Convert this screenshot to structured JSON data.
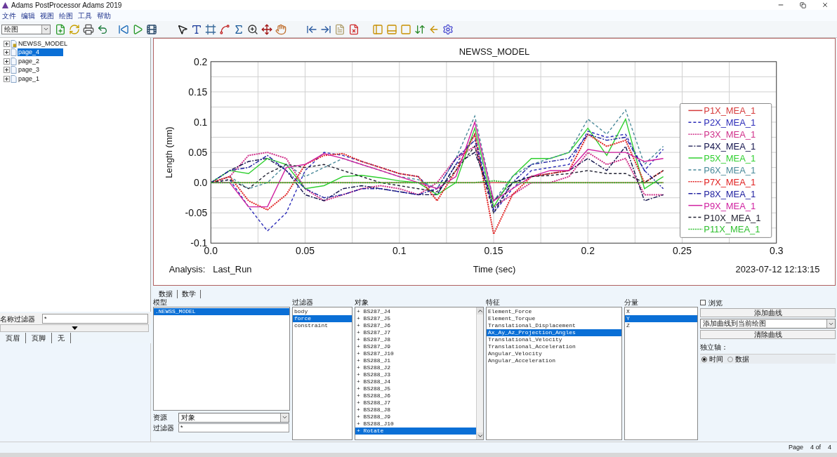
{
  "window": {
    "title": "Adams PostProcessor Adams 2019"
  },
  "menu": [
    "文件",
    "编辑",
    "视图",
    "绘图",
    "工具",
    "帮助"
  ],
  "toolbar": {
    "mode_select": "绘图"
  },
  "tree": [
    {
      "label": "NEWSS_MODEL",
      "kind": "model",
      "selected": false,
      "expanded": false
    },
    {
      "label": "page_4",
      "kind": "page",
      "selected": true,
      "expanded": false
    },
    {
      "label": "page_2",
      "kind": "page",
      "selected": false,
      "expanded": false
    },
    {
      "label": "page_3",
      "kind": "page",
      "selected": false,
      "expanded": false
    },
    {
      "label": "page_1",
      "kind": "page",
      "selected": false,
      "expanded": false
    }
  ],
  "name_filter": {
    "label": "名称过滤器",
    "value": "*"
  },
  "header_tabs": [
    "页眉",
    "页脚",
    "无"
  ],
  "plot": {
    "analysis_label": "Analysis:",
    "analysis_name": "Last_Run",
    "timestamp": "2023-07-12 12:13:15",
    "chart_data": {
      "type": "line",
      "title": "NEWSS_MODEL",
      "xlabel": "Time (sec)",
      "ylabel": "Length (mm)",
      "grid": true,
      "legend": true,
      "x": [
        0,
        0.01,
        0.02,
        0.03,
        0.04,
        0.05,
        0.06,
        0.07,
        0.08,
        0.09,
        0.1,
        0.11,
        0.12,
        0.13,
        0.14,
        0.15,
        0.16,
        0.17,
        0.18,
        0.19,
        0.2,
        0.21,
        0.22,
        0.23,
        0.24
      ],
      "xlim": [
        0,
        0.3
      ],
      "ylim": [
        -0.1,
        0.2
      ],
      "xticks": [
        {
          "value": 0,
          "label": "0.0"
        },
        0.05,
        0.1,
        0.15,
        0.2,
        0.25,
        0.3
      ],
      "yticks": [
        -0.1,
        -0.05,
        {
          "value": 0,
          "label": "0.0"
        },
        0.05,
        0.1,
        0.15,
        0.2
      ],
      "series": [
        {
          "name": "P1X_MEA_1",
          "color": "#d63a3a",
          "line_style": "solid",
          "values": [
            0,
            0,
            0,
            0,
            0,
            0,
            0,
            0,
            0,
            0,
            0,
            0,
            0,
            0,
            0,
            0,
            0,
            0,
            0,
            0,
            0,
            0,
            0,
            0,
            0
          ]
        },
        {
          "name": "P2X_MEA_1",
          "color": "#2a2ab8",
          "line_style": "dashed",
          "values": [
            0,
            0.005,
            -0.04,
            -0.08,
            -0.05,
            0.02,
            0.05,
            0.045,
            0.035,
            0.025,
            0.015,
            0.01,
            -0.02,
            0.03,
            0.08,
            -0.05,
            -0.01,
            0.02,
            0.025,
            0.03,
            0.085,
            0.075,
            0.08,
            0.02,
            0.055
          ]
        },
        {
          "name": "P3X_MEA_1",
          "color": "#d0308a",
          "line_style": "dotted",
          "values": [
            0,
            0.01,
            0.045,
            0.05,
            0.04,
            -0.01,
            -0.03,
            -0.02,
            -0.01,
            -0.005,
            -0.01,
            -0.02,
            0,
            0.04,
            0.06,
            -0.04,
            -0.02,
            0,
            0,
            0.01,
            0.05,
            0.03,
            0.04,
            -0.02,
            -0.02
          ]
        },
        {
          "name": "P4X_MEA_1",
          "color": "#10104a",
          "line_style": "dashdot",
          "values": [
            0,
            0.02,
            0.035,
            0.04,
            0.02,
            -0.02,
            -0.03,
            -0.01,
            -0.005,
            -0.01,
            -0.015,
            -0.02,
            -0.02,
            0.03,
            0.05,
            -0.03,
            0,
            0.01,
            0.015,
            0.02,
            0.04,
            0.02,
            0.06,
            -0.03,
            -0.02
          ]
        },
        {
          "name": "P5X_MEA_1",
          "color": "#30d030",
          "line_style": "solid",
          "values": [
            0,
            0.02,
            0.015,
            0.04,
            0.03,
            -0.01,
            -0.005,
            0.01,
            0.012,
            0.008,
            0.003,
            0,
            -0.02,
            0,
            0.09,
            -0.04,
            0.01,
            0.04,
            0.04,
            0.05,
            0.09,
            0.045,
            0.105,
            -0.01,
            0.01
          ]
        },
        {
          "name": "P6X_MEA_1",
          "color": "#4a8a9a",
          "line_style": "dashed",
          "values": [
            0,
            0.01,
            -0.01,
            0,
            0.03,
            0.01,
            0.025,
            0.04,
            0.03,
            0.02,
            0.01,
            0.005,
            -0.01,
            0.04,
            0.11,
            -0.03,
            0.01,
            0.03,
            0.04,
            0.05,
            0.105,
            0.08,
            0.12,
            0.03,
            0.06
          ]
        },
        {
          "name": "P7X_MEA_1",
          "color": "#e02020",
          "line_style": "dotted",
          "values": [
            0,
            0.01,
            -0.03,
            -0.045,
            -0.02,
            0.03,
            0.045,
            0.048,
            0.035,
            0.025,
            0.015,
            0.01,
            -0.03,
            0.02,
            0.08,
            -0.085,
            -0.02,
            0.01,
            0.015,
            0.02,
            0.08,
            0.06,
            0.07,
            0,
            0.02
          ]
        },
        {
          "name": "P8X_MEA_1",
          "color": "#2020a0",
          "line_style": "dashdot",
          "values": [
            0,
            0.02,
            0.025,
            0.045,
            0.02,
            -0.01,
            -0.025,
            -0.02,
            -0.01,
            -0.01,
            -0.015,
            -0.02,
            -0.01,
            0.04,
            0.07,
            -0.045,
            0,
            0.03,
            0.035,
            0.04,
            0.08,
            0.07,
            0.075,
            0.02,
            -0.01
          ]
        },
        {
          "name": "P9X_MEA_1",
          "color": "#d020a0",
          "line_style": "solid",
          "values": [
            0,
            0,
            -0.04,
            -0.04,
            0.025,
            0.03,
            0.048,
            0.04,
            0.03,
            0.02,
            0.01,
            0,
            -0.01,
            0.01,
            0.1,
            -0.03,
            -0.01,
            0.01,
            0.02,
            0.02,
            0.055,
            0.05,
            0.05,
            0.035,
            0.04
          ]
        },
        {
          "name": "P10X_MEA_1",
          "color": "#202030",
          "line_style": "dashed",
          "values": [
            0,
            0.005,
            -0.01,
            0.015,
            0.03,
            0.025,
            0.03,
            0.02,
            0.01,
            0,
            -0.005,
            -0.01,
            -0.015,
            0.02,
            0.06,
            -0.05,
            0,
            0.01,
            0.012,
            0.015,
            0.02,
            0.015,
            0.015,
            0,
            0.02
          ]
        },
        {
          "name": "P11X_MEA_1",
          "color": "#30c030",
          "line_style": "dotted",
          "values": [
            0,
            0,
            0,
            0,
            0,
            0,
            0,
            0,
            0,
            0,
            0,
            0,
            0,
            0,
            0,
            0.003,
            0,
            0,
            0,
            0,
            0,
            0,
            0,
            0,
            0
          ]
        }
      ]
    }
  },
  "data_panel": {
    "tabs": [
      "数据",
      "数学"
    ],
    "model": {
      "label": "模型",
      "items": [
        {
          "label": ".NEWSS_MODEL",
          "selected": true
        }
      ]
    },
    "filter": {
      "label": "过滤器",
      "items": [
        {
          "label": "body",
          "selected": false
        },
        {
          "label": "force",
          "selected": true
        },
        {
          "label": "constraint",
          "selected": false
        }
      ]
    },
    "objects": {
      "label": "对象",
      "items": [
        {
          "label": "+ BS287_J4",
          "selected": false
        },
        {
          "label": "+ BS287_J5",
          "selected": false
        },
        {
          "label": "+ BS287_J6",
          "selected": false
        },
        {
          "label": "+ BS287_J7",
          "selected": false
        },
        {
          "label": "+ BS287_J8",
          "selected": false
        },
        {
          "label": "+ BS287_J9",
          "selected": false
        },
        {
          "label": "+ BS287_J10",
          "selected": false
        },
        {
          "label": "+ BS288_J1",
          "selected": false
        },
        {
          "label": "+ BS288_J2",
          "selected": false
        },
        {
          "label": "+ BS288_J3",
          "selected": false
        },
        {
          "label": "+ BS288_J4",
          "selected": false
        },
        {
          "label": "+ BS288_J5",
          "selected": false
        },
        {
          "label": "+ BS288_J6",
          "selected": false
        },
        {
          "label": "+ BS288_J7",
          "selected": false
        },
        {
          "label": "+ BS288_J8",
          "selected": false
        },
        {
          "label": "+ BS288_J9",
          "selected": false
        },
        {
          "label": "+ BS288_J10",
          "selected": false
        },
        {
          "label": "+ Rotate",
          "selected": true
        }
      ]
    },
    "features": {
      "label": "特征",
      "items": [
        {
          "label": "Element_Force",
          "selected": false
        },
        {
          "label": "Element_Torque",
          "selected": false
        },
        {
          "label": "Translational_Displacement",
          "selected": false
        },
        {
          "label": "Ax_Ay_Az_Projection_Angles",
          "selected": true
        },
        {
          "label": "Translational_Velocity",
          "selected": false
        },
        {
          "label": "Translational_Acceleration",
          "selected": false
        },
        {
          "label": "Angular_Velocity",
          "selected": false
        },
        {
          "label": "Angular_Acceleration",
          "selected": false
        }
      ]
    },
    "components": {
      "label": "分量",
      "items": [
        {
          "label": "X",
          "selected": false
        },
        {
          "label": "Y",
          "selected": true
        },
        {
          "label": "Z",
          "selected": false
        }
      ]
    },
    "source": {
      "label": "资源",
      "value": "对象"
    },
    "filter_field": {
      "label": "过滤器",
      "value": "*"
    },
    "browse": {
      "label": "浏览",
      "checked": false
    },
    "add_button": "添加曲线",
    "add_mode": "添加曲线到当前绘图",
    "clear_button": "清除曲线",
    "axis_label": "独立轴：",
    "axis_options": [
      {
        "label": "时间",
        "selected": true
      },
      {
        "label": "数据",
        "selected": false
      }
    ]
  },
  "status": {
    "page_label": "Page",
    "page_of": "4 of",
    "page_total": "4"
  }
}
